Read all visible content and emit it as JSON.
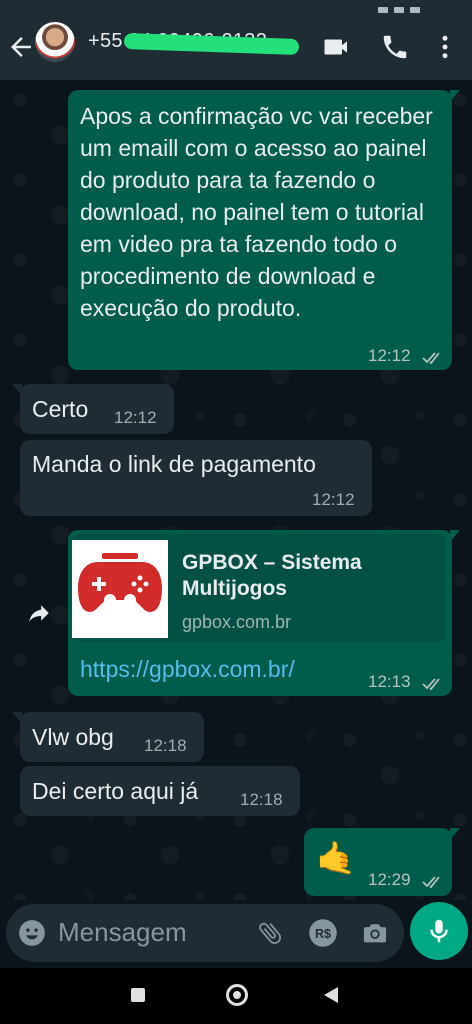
{
  "header": {
    "contact_name": "+55 84 99406-2132",
    "icons": [
      "back-arrow-icon",
      "video-call-icon",
      "voice-call-icon",
      "more-options-icon"
    ]
  },
  "messages": [
    {
      "direction": "outgoing",
      "text": "Apos a confirmação vc vai receber um emaill com o acesso ao painel do produto para ta fazendo o download, no painel tem o tutorial em video pra ta fazendo todo o procedimento de download e execução do produto.",
      "time": "12:12",
      "status": "read"
    },
    {
      "direction": "incoming",
      "text": "Certo",
      "time": "12:12"
    },
    {
      "direction": "incoming",
      "text": "Manda o link de pagamento",
      "time": "12:12"
    },
    {
      "direction": "outgoing",
      "type": "link",
      "preview_title": "GPBOX – Sistema Multijogos",
      "preview_domain": "gpbox.com.br",
      "text": "https://gpbox.com.br/",
      "time": "12:13",
      "status": "read"
    },
    {
      "direction": "incoming",
      "text": "Vlw obg",
      "time": "12:18"
    },
    {
      "direction": "incoming",
      "text": "Dei certo aqui já",
      "time": "12:18"
    },
    {
      "direction": "outgoing",
      "text": "🤙",
      "time": "12:29",
      "status": "read"
    }
  ],
  "input": {
    "placeholder": "Mensagem"
  },
  "colors": {
    "header_bg": "#1f2c34",
    "outgoing_bubble": "#005c4b",
    "incoming_bubble": "#202c33",
    "link": "#53bdeb",
    "accent": "#00a884",
    "read_ticks": "#b6c4c0"
  }
}
